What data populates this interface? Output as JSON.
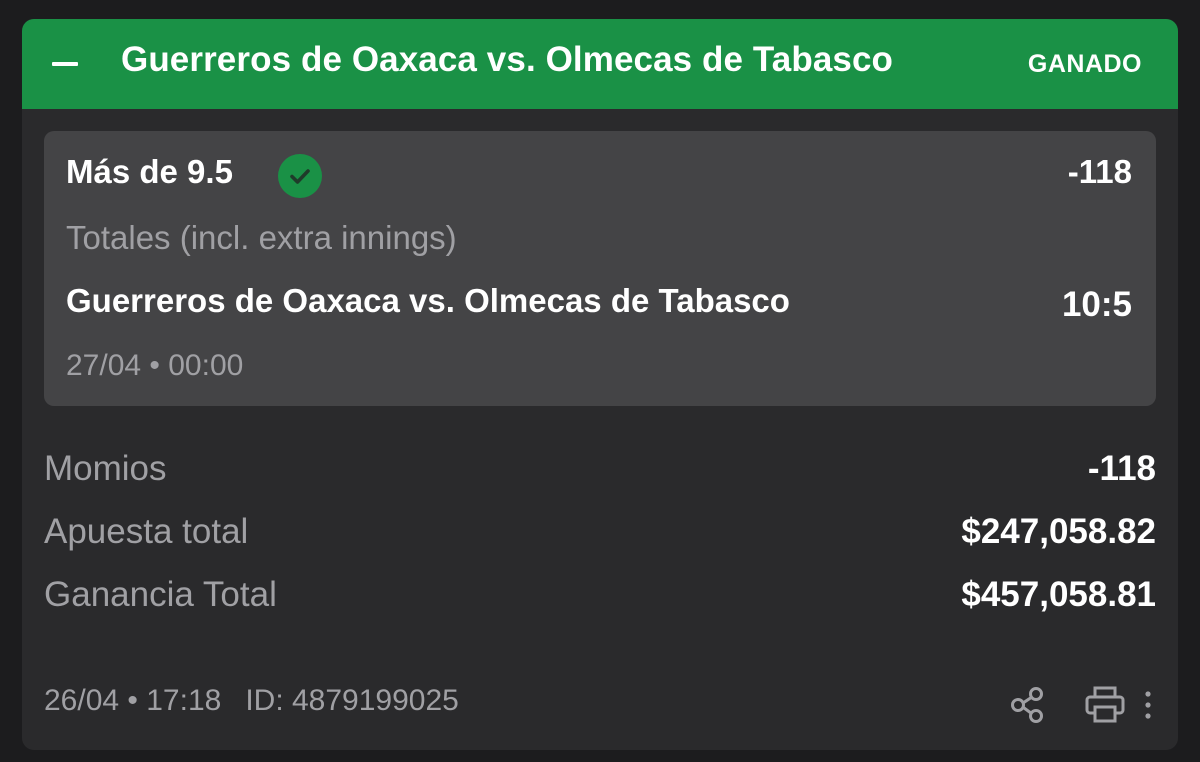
{
  "header": {
    "title": "Guerreros de Oaxaca vs. Olmecas de Tabasco",
    "status": "GANADO",
    "accent_color": "#1a9146",
    "collapse_icon": "minus-icon"
  },
  "selection": {
    "name": "Más de 9.5",
    "check_icon": "check-circle-icon",
    "odds": "-118",
    "market": "Totales (incl. extra innings)",
    "event": "Guerreros de Oaxaca vs. Olmecas de Tabasco",
    "score": "10:5",
    "date": "27/04 • 00:00"
  },
  "summary": [
    {
      "label": "Momios",
      "value": "-118"
    },
    {
      "label": "Apuesta total",
      "value": "$247,058.82"
    },
    {
      "label": "Ganancia Total",
      "value": "$457,058.81"
    }
  ],
  "footer": {
    "placed": "26/04 • 17:18",
    "id": "ID: 4879199025",
    "icons": [
      "share-icon",
      "print-icon",
      "more-vertical-icon"
    ]
  }
}
